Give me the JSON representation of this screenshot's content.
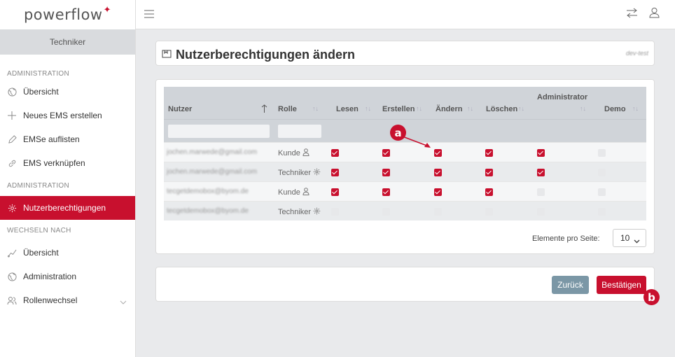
{
  "app": {
    "logo": "powerflow",
    "logo_mark": "✦"
  },
  "sidebar": {
    "role": "Techniker",
    "sections": [
      {
        "title": "ADMINISTRATION",
        "items": [
          {
            "label": "Übersicht",
            "icon": "globe-icon"
          },
          {
            "label": "Neues EMS erstellen",
            "icon": "plus-icon"
          },
          {
            "label": "EMSe auflisten",
            "icon": "pencil-icon"
          },
          {
            "label": "EMS verknüpfen",
            "icon": "link-icon"
          }
        ]
      },
      {
        "title": "ADMINISTRATION",
        "items": [
          {
            "label": "Nutzerberechtigungen",
            "icon": "gear-icon"
          }
        ]
      },
      {
        "title": "WECHSELN NACH",
        "items": [
          {
            "label": "Übersicht",
            "icon": "chart-icon"
          },
          {
            "label": "Administration",
            "icon": "globe-icon"
          },
          {
            "label": "Rollenwechsel",
            "icon": "users-icon"
          }
        ]
      }
    ]
  },
  "page": {
    "title": "Nutzerberechtigungen ändern",
    "env_tag": "dev-test"
  },
  "table": {
    "group_header": "Administrator",
    "columns": [
      "Nutzer",
      "Rolle",
      "Lesen",
      "Erstellen",
      "Ändern",
      "Löschen",
      "",
      "Demo"
    ],
    "rows": [
      {
        "email": "jochen.marwede@gmail.com",
        "role": "Kunde",
        "perms": [
          true,
          true,
          true,
          true,
          true,
          false
        ]
      },
      {
        "email": "jochen.marwede@gmail.com",
        "role": "Techniker",
        "perms": [
          true,
          true,
          true,
          true,
          true,
          false
        ]
      },
      {
        "email": "tecgetdemobox@byom.de",
        "role": "Kunde",
        "perms": [
          true,
          true,
          true,
          true,
          false,
          false
        ]
      },
      {
        "email": "tecgetdemobox@byom.de",
        "role": "Techniker",
        "perms": [
          false,
          false,
          false,
          false,
          false,
          false
        ]
      }
    ]
  },
  "pagination": {
    "label": "Elemente pro Seite:",
    "value": "10"
  },
  "actions": {
    "back": "Zurück",
    "confirm": "Bestätigen"
  },
  "annotations": {
    "a": "a",
    "b": "b"
  },
  "colors": {
    "accent": "#c8102e",
    "secondary": "#7b97a6"
  }
}
